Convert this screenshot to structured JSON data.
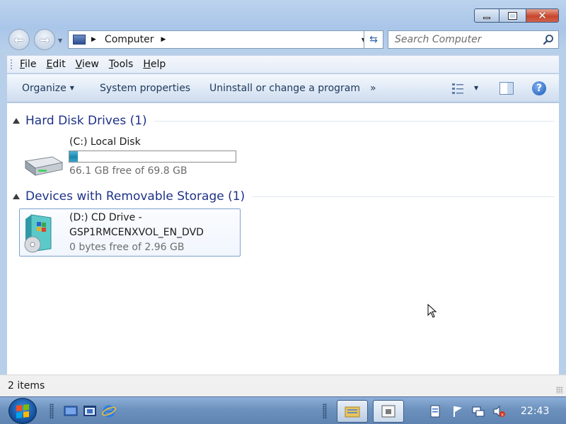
{
  "window": {
    "caption": {
      "minimize": "minimize",
      "maximize": "maximize",
      "close": "close"
    }
  },
  "navigation": {
    "address": "Computer",
    "search_placeholder": "Search Computer"
  },
  "menubar": {
    "items": [
      "File",
      "Edit",
      "View",
      "Tools",
      "Help"
    ]
  },
  "commandbar": {
    "organize": "Organize",
    "system_properties": "System properties",
    "uninstall": "Uninstall or change a program",
    "more": "»"
  },
  "groups": [
    {
      "title": "Hard Disk Drives (1)",
      "drives": [
        {
          "name": "(C:) Local Disk",
          "free_text": "66.1 GB free of 69.8 GB",
          "used_fraction": 0.053
        }
      ]
    },
    {
      "title": "Devices with Removable Storage (1)",
      "drives": [
        {
          "name_line1": "(D:) CD Drive -",
          "name_line2": "GSP1RMCENXVOL_EN_DVD",
          "free_text": "0 bytes free of 2.96 GB"
        }
      ]
    }
  ],
  "statusbar": {
    "text": "2 items"
  },
  "taskbar": {
    "clock": "22:43"
  },
  "colors": {
    "accent": "#1e3287",
    "usage_fill": "#1d87ad",
    "close_button": "#c7462b"
  }
}
